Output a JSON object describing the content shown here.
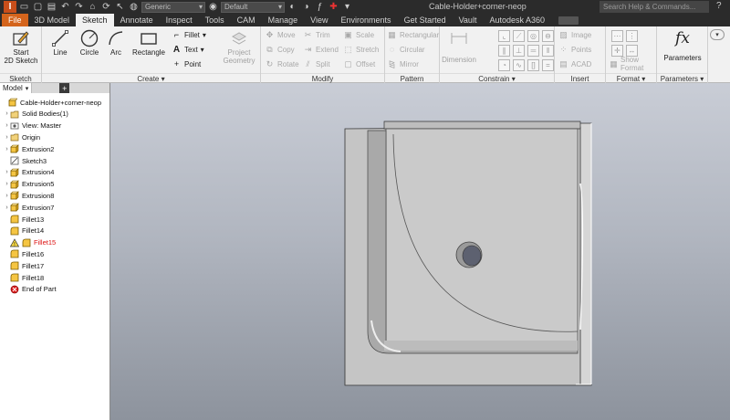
{
  "app": {
    "title": "Cable-Holder+corner-neop",
    "search_placeholder": "Search Help & Commands...",
    "material": "Generic",
    "appearance": "Default"
  },
  "tabs": [
    "File",
    "3D Model",
    "Sketch",
    "Annotate",
    "Inspect",
    "Tools",
    "CAM",
    "Manage",
    "View",
    "Environments",
    "Get Started",
    "Vault",
    "Autodesk A360"
  ],
  "active_tab": "Sketch",
  "ribbon": {
    "sketch_panel": {
      "label": "Sketch",
      "start": "Start\n2D Sketch"
    },
    "create_panel": {
      "label": "Create",
      "line": "Line",
      "circle": "Circle",
      "arc": "Arc",
      "rectangle": "Rectangle",
      "fillet": "Fillet",
      "text": "Text",
      "point": "Point",
      "project": "Project\nGeometry"
    },
    "modify_panel": {
      "label": "Modify",
      "move": "Move",
      "trim": "Trim",
      "scale": "Scale",
      "copy": "Copy",
      "extend": "Extend",
      "stretch": "Stretch",
      "rotate": "Rotate",
      "split": "Split",
      "offset": "Offset"
    },
    "pattern_panel": {
      "label": "Pattern",
      "rectangular": "Rectangular",
      "circular": "Circular",
      "mirror": "Mirror"
    },
    "constrain_panel": {
      "label": "Constrain",
      "dimension": "Dimension"
    },
    "insert_panel": {
      "label": "Insert",
      "image": "Image",
      "points": "Points",
      "acad": "ACAD"
    },
    "format_panel": {
      "label": "Format",
      "show_format": "Show Format"
    },
    "parameters_panel": {
      "label": "Parameters",
      "parameters": "Parameters"
    }
  },
  "browser": {
    "tab": "Model",
    "add": "+",
    "items": [
      {
        "label": "Cable-Holder+corner-neop",
        "icon": "part-icon",
        "expand": false,
        "indent": 0
      },
      {
        "label": "Solid Bodies(1)",
        "icon": "folder-icon",
        "expand": true,
        "indent": 1
      },
      {
        "label": "View: Master",
        "icon": "view-icon",
        "expand": true,
        "indent": 1
      },
      {
        "label": "Origin",
        "icon": "folder-icon",
        "expand": true,
        "indent": 1
      },
      {
        "label": "Extrusion2",
        "icon": "extrusion-icon",
        "expand": true,
        "indent": 1
      },
      {
        "label": "Sketch3",
        "icon": "sketch-icon",
        "expand": false,
        "indent": 1
      },
      {
        "label": "Extrusion4",
        "icon": "extrusion-icon",
        "expand": true,
        "indent": 1
      },
      {
        "label": "Extrusion5",
        "icon": "extrusion-icon",
        "expand": true,
        "indent": 1
      },
      {
        "label": "Extrusion8",
        "icon": "extrusion-icon",
        "expand": true,
        "indent": 1
      },
      {
        "label": "Extrusion7",
        "icon": "extrusion-icon",
        "expand": true,
        "indent": 1
      },
      {
        "label": "Fillet13",
        "icon": "fillet-icon",
        "expand": false,
        "indent": 1
      },
      {
        "label": "Fillet14",
        "icon": "fillet-icon",
        "expand": false,
        "indent": 1
      },
      {
        "label": "Fillet15",
        "icon": "fillet-icon",
        "expand": false,
        "indent": 1,
        "warning": true
      },
      {
        "label": "Fillet16",
        "icon": "fillet-icon",
        "expand": false,
        "indent": 1
      },
      {
        "label": "Fillet17",
        "icon": "fillet-icon",
        "expand": false,
        "indent": 1
      },
      {
        "label": "Fillet18",
        "icon": "fillet-icon",
        "expand": false,
        "indent": 1
      },
      {
        "label": "End of Part",
        "icon": "end-of-part-icon",
        "expand": false,
        "indent": 1
      }
    ]
  },
  "colors": {
    "accent": "#d4641c",
    "warning": "#dd1111",
    "part_face": "#c8c8c8"
  }
}
